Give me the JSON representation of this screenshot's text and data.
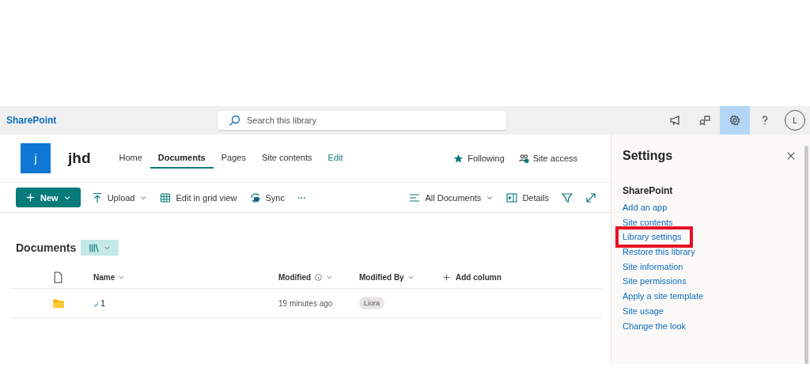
{
  "suite_bar": {
    "brand": "SharePoint",
    "search": {
      "placeholder": "Search this library"
    },
    "icons": [
      {
        "kind": "megaphone",
        "selected": false
      },
      {
        "kind": "chat",
        "selected": false
      },
      {
        "kind": "gear",
        "selected": true
      },
      {
        "kind": "help",
        "selected": false
      }
    ],
    "avatar": "L"
  },
  "site": {
    "logo": "j",
    "title": "jhd",
    "nav": [
      {
        "label": "Home",
        "selected": false,
        "kind": "tab"
      },
      {
        "label": "Documents",
        "selected": true,
        "kind": "tab"
      },
      {
        "label": "Pages",
        "selected": false,
        "kind": "tab"
      },
      {
        "label": "Site contents",
        "selected": false,
        "kind": "tab"
      },
      {
        "label": "Edit",
        "selected": false,
        "kind": "edit"
      }
    ],
    "actions": [
      {
        "kind": "star",
        "label": "Following"
      },
      {
        "kind": "people",
        "label": "Site access"
      }
    ]
  },
  "command_bar": {
    "left": [
      {
        "kind": "new",
        "label": "New"
      },
      {
        "kind": "upload",
        "label": "Upload"
      },
      {
        "kind": "grid",
        "label": "Edit in grid view"
      },
      {
        "kind": "sync",
        "label": "Sync"
      },
      {
        "kind": "more",
        "label": "···"
      }
    ],
    "right": [
      {
        "kind": "view",
        "label": "All Documents"
      },
      {
        "kind": "details",
        "label": "Details"
      },
      {
        "kind": "filter"
      },
      {
        "kind": "expand"
      }
    ]
  },
  "library": {
    "title": "Documents",
    "columns": [
      {
        "label": "Name",
        "info": false
      },
      {
        "label": "Modified",
        "info": true
      },
      {
        "label": "Modified By",
        "info": false
      }
    ],
    "add_column": "Add column",
    "rows": [
      {
        "kind": "folder",
        "name": "1",
        "new": true,
        "modified": "19 minutes ago",
        "modified_by": "Liora"
      }
    ]
  },
  "settings_panel": {
    "title": "Settings",
    "section": "SharePoint",
    "links": [
      {
        "label": "Add an app",
        "highlighted": false
      },
      {
        "label": "Site contents",
        "highlighted": false
      },
      {
        "label": "Library settings",
        "highlighted": true
      },
      {
        "label": "Restore this library",
        "highlighted": false
      },
      {
        "label": "Site information",
        "highlighted": false
      },
      {
        "label": "Site permissions",
        "highlighted": false
      },
      {
        "label": "Apply a site template",
        "highlighted": false
      },
      {
        "label": "Site usage",
        "highlighted": false
      },
      {
        "label": "Change the look",
        "highlighted": false
      }
    ]
  }
}
